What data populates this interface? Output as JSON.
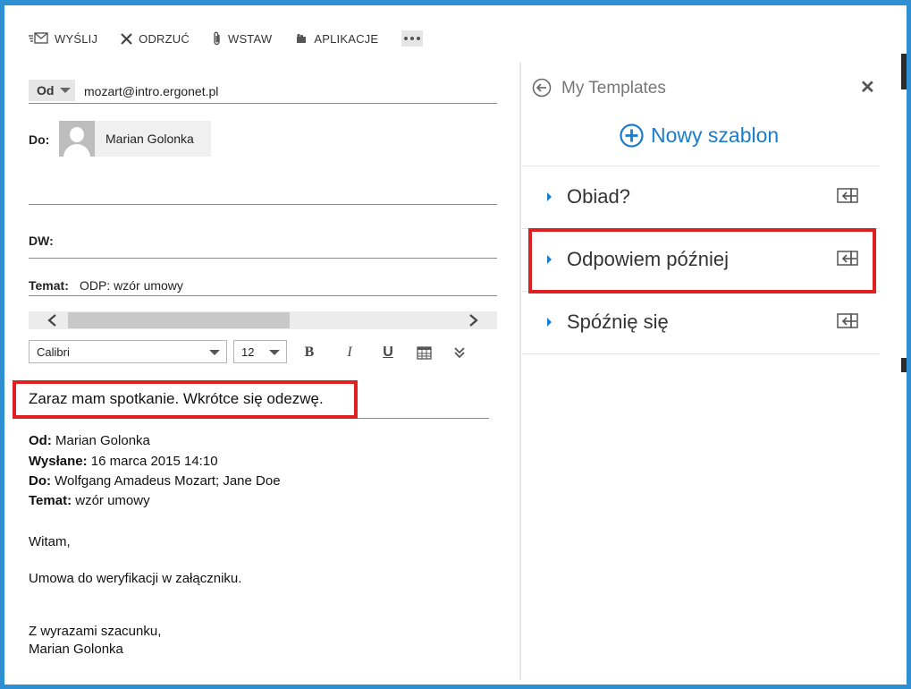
{
  "toolbar": {
    "send": "WYŚLIJ",
    "discard": "ODRZUĆ",
    "insert": "WSTAW",
    "apps": "APLIKACJE"
  },
  "from": {
    "button_label": "Od",
    "address": "mozart@intro.ergonet.pl"
  },
  "to": {
    "label": "Do:",
    "recipient": "Marian Golonka"
  },
  "cc": {
    "label": "DW:"
  },
  "subject": {
    "label": "Temat:",
    "value": "ODP: wzór umowy"
  },
  "format": {
    "font": "Calibri",
    "size": "12",
    "bold": "B",
    "italic": "I",
    "underline": "U"
  },
  "body": {
    "reply_text": "Zaraz mam spotkanie. Wkrótce się odezwę.",
    "quoted": {
      "from_label": "Od:",
      "from_value": "Marian Golonka",
      "sent_label": "Wysłane:",
      "sent_value": "16 marca 2015 14:10",
      "to_label": "Do:",
      "to_value": "Wolfgang Amadeus Mozart; Jane Doe",
      "subject_label": "Temat:",
      "subject_value": "wzór umowy",
      "greeting": "Witam,",
      "text": "Umowa do weryfikacji w załączniku.",
      "closing": "Z wyrazami szacunku,",
      "signature": "Marian Golonka"
    }
  },
  "templates": {
    "title": "My Templates",
    "new_label": "Nowy szablon",
    "items": [
      {
        "name": "Obiad?"
      },
      {
        "name": "Odpowiem później"
      },
      {
        "name": "Spóźnię się"
      }
    ]
  },
  "colors": {
    "accent": "#1a7ccf",
    "frame": "#2f8fd3",
    "highlight": "#e02020"
  }
}
